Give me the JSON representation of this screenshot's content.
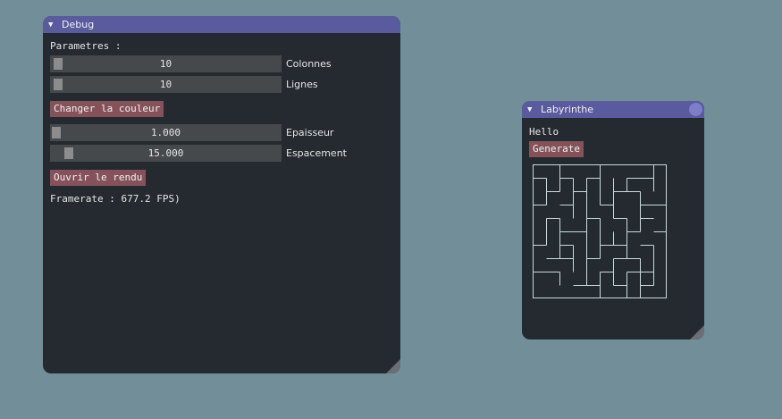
{
  "debug_window": {
    "title": "Debug",
    "arrow": "▼",
    "params_label": "Parametres :",
    "sliders": [
      {
        "value": "10",
        "label": "Colonnes",
        "level": 0.0
      },
      {
        "value": "10",
        "label": "Lignes",
        "level": 0.0
      },
      {
        "value": "1.000",
        "label": "Epaisseur",
        "level": 0.0
      },
      {
        "value": "15.000",
        "label": "Espacement",
        "level": 0.06
      }
    ],
    "change_color_label": "Changer la couleur",
    "open_render_label": "Ouvrir le rendu",
    "framerate_text": "Framerate : 677.2 FPS)"
  },
  "maze_window": {
    "title": "Labyrinthe",
    "arrow": "▼",
    "hello_text": "Hello",
    "generate_label": "Generate",
    "maze_color": "#c8dcdc"
  },
  "colors": {
    "background": "#728f99",
    "window_bg": "#242a2f",
    "titlebar": "#5a5a9e",
    "button": "#85525a",
    "slider_frame": "#46494c"
  }
}
